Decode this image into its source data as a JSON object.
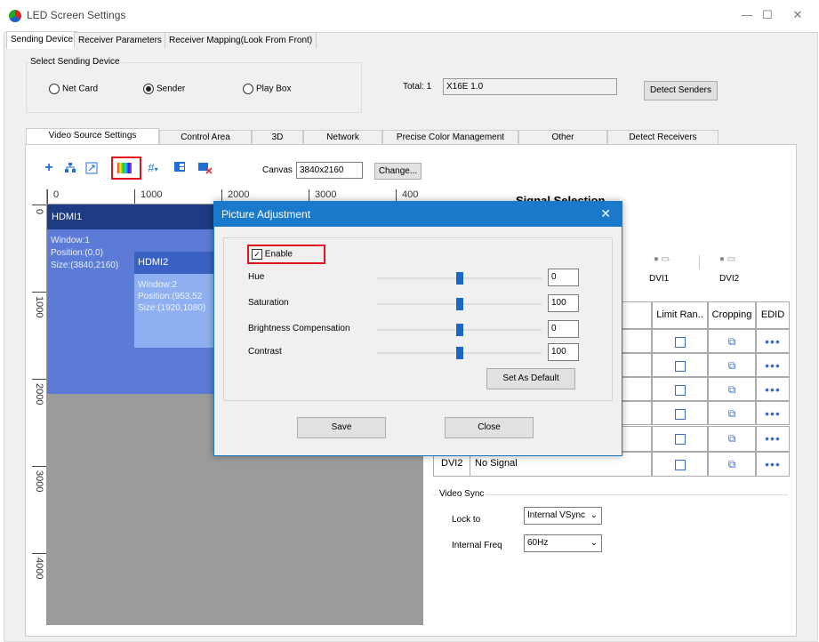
{
  "window": {
    "title": "LED Screen Settings",
    "minimize": "—",
    "maximize": "☐",
    "close": "✕"
  },
  "main_tabs": [
    {
      "label": "Sending Device"
    },
    {
      "label": "Receiver Parameters"
    },
    {
      "label": "Receiver Mapping(Look From Front)"
    }
  ],
  "select_device": {
    "label": "Select Sending Device",
    "options": [
      "Net Card",
      "Sender",
      "Play Box"
    ],
    "selected": "Sender",
    "total_label": "Total: 1",
    "device_value": "X16E 1.0",
    "detect_button": "Detect Senders"
  },
  "sub_tabs": [
    {
      "label": "Video Source Settings"
    },
    {
      "label": "Control Area"
    },
    {
      "label": "3D"
    },
    {
      "label": "Network"
    },
    {
      "label": "Precise Color Management"
    },
    {
      "label": "Other"
    },
    {
      "label": "Detect Receivers"
    }
  ],
  "toolbar": {
    "icons": [
      "add-icon",
      "tree-icon",
      "fit-icon",
      "picture-adjustment-icon",
      "grid-icon",
      "layout-icon",
      "window-delete-icon"
    ],
    "canvas_label": "Canvas",
    "canvas_value": "3840x2160",
    "change_button": "Change..."
  },
  "rulers": {
    "h_labels": [
      "0",
      "1000",
      "2000",
      "3000",
      "400"
    ],
    "v_labels": [
      "0",
      "1000",
      "2000",
      "3000",
      "4000"
    ]
  },
  "layers": {
    "hdmi1": {
      "name": "HDMI1",
      "line1": "Window:1",
      "line2": "Position:(0,0)",
      "line3": "Size:(3840,2160)"
    },
    "hdmi2": {
      "name": "HDMI2",
      "line1": "Window:2",
      "line2": "Position:(953,52",
      "line3": "Size:(1920,1080)"
    }
  },
  "signal": {
    "title": "Signal Selection",
    "inputs": [
      "DVI1",
      "DVI2"
    ],
    "headers": [
      "Limit Ran..",
      "Cropping",
      "EDID"
    ],
    "last_row": {
      "source": "DVI2",
      "status": "No Signal"
    }
  },
  "video_sync": {
    "label": "Video Sync",
    "lock_label": "Lock to",
    "lock_value": "Internal VSync",
    "freq_label": "Internal Freq",
    "freq_value": "60Hz"
  },
  "dialog": {
    "title": "Picture Adjustment",
    "enable_label": "Enable",
    "enable_checked": true,
    "sliders": [
      {
        "label": "Hue",
        "value": "0",
        "level": 0.5
      },
      {
        "label": "Saturation",
        "value": "100",
        "level": 0.5
      },
      {
        "label": "Brightness Compensation",
        "value": "0",
        "level": 0.5
      },
      {
        "label": "Contrast",
        "value": "100",
        "level": 0.5
      }
    ],
    "default_button": "Set As Default",
    "save_button": "Save",
    "close_button": "Close"
  },
  "colors": {
    "accent": "#1979ca",
    "highlight": "#e0141e",
    "window1": "#5c7bd6",
    "window2": "#8fb0f0"
  }
}
